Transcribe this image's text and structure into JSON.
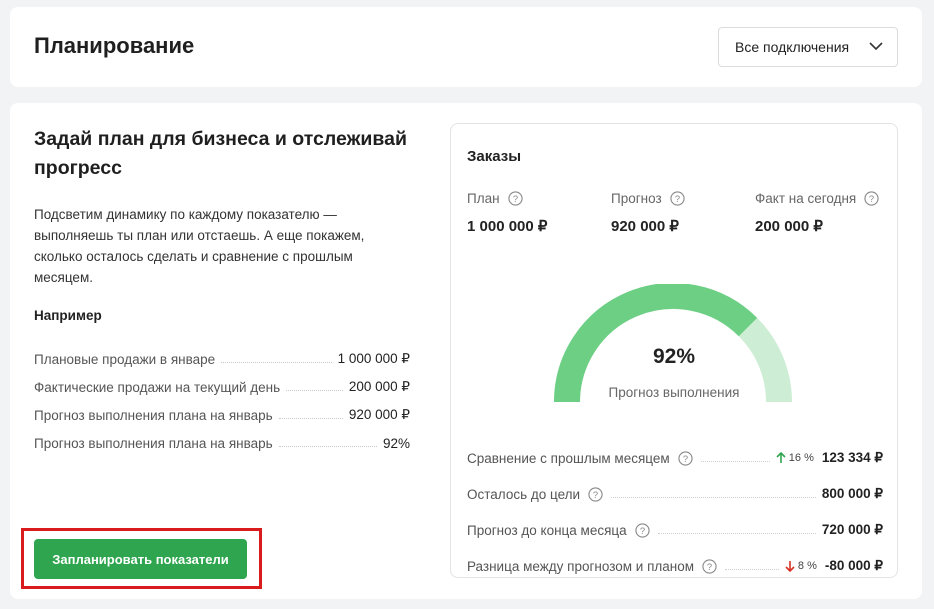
{
  "header": {
    "title": "Планирование",
    "connections_dropdown": {
      "selected": "Все подключения"
    }
  },
  "promo": {
    "title": "Задай план для бизнеса и отслеживай прогресс",
    "description": "Подсветим динамику по каждому показателю — выполняешь ты план или отстаешь. А еще покажем, сколько осталось сделать и сравнение с прошлым месяцем.",
    "example_heading": "Например",
    "examples": [
      {
        "label": "Плановые продажи в январе",
        "value": "1 000 000 ₽"
      },
      {
        "label": "Фактические продажи на текущий день",
        "value": "200 000 ₽"
      },
      {
        "label": "Прогноз выполнения плана на январь",
        "value": "920 000 ₽"
      },
      {
        "label": "Прогноз выполнения плана на январь",
        "value": "92%"
      }
    ],
    "button_label": "Запланировать показатели"
  },
  "orders": {
    "title": "Заказы",
    "metrics": [
      {
        "label": "План",
        "value": "1 000 000 ₽"
      },
      {
        "label": "Прогноз",
        "value": "920 000 ₽"
      },
      {
        "label": "Факт на сегодня",
        "value": "200 000 ₽"
      }
    ],
    "gauge": {
      "percent_label": "92%",
      "fraction": 0.75,
      "caption": "Прогноз выполнения",
      "fill_color": "#6ccf84",
      "track_color": "#cdeed5"
    },
    "stats": [
      {
        "label": "Сравнение с прошлым месяцем",
        "trend": "16 %",
        "trend_dir": "up",
        "value": "123 334 ₽"
      },
      {
        "label": "Осталось до цели",
        "trend": "",
        "trend_dir": "",
        "value": "800 000 ₽"
      },
      {
        "label": "Прогноз до конца месяца",
        "trend": "",
        "trend_dir": "",
        "value": "720 000 ₽"
      },
      {
        "label": "Разница между прогнозом и планом",
        "trend": "8 %",
        "trend_dir": "down",
        "value": "-80 000 ₽"
      }
    ]
  },
  "colors": {
    "accent_green": "#2ea54e",
    "trend_up": "#2ea54e",
    "trend_down": "#d93025",
    "highlight": "#d91b1b"
  }
}
